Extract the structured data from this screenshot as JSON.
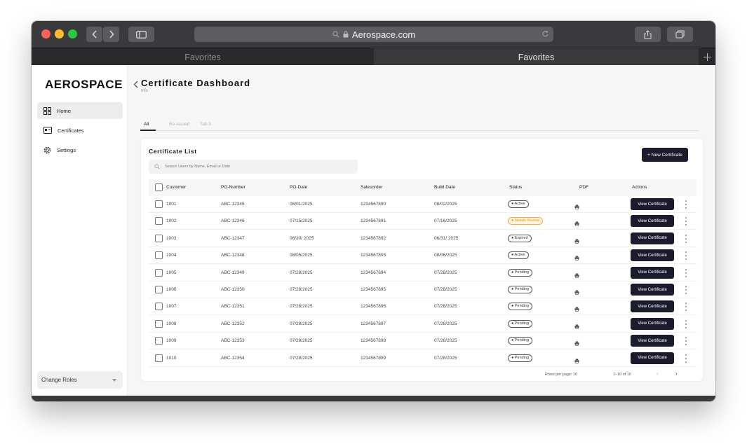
{
  "browser": {
    "url": "Aerospace.com",
    "tabs": [
      {
        "label": "Favorites",
        "active": false
      },
      {
        "label": "Favorites",
        "active": true
      }
    ],
    "colors": {
      "close": "#fe5f57",
      "minimize": "#febc2e",
      "maximize": "#28c840"
    }
  },
  "sidebar": {
    "logo": "AEROSPACE",
    "items": [
      {
        "label": "Home",
        "icon": "grid-icon",
        "active": true
      },
      {
        "label": "Certificates",
        "icon": "certificate-icon",
        "active": false
      },
      {
        "label": "Settings",
        "icon": "gear-icon",
        "active": false
      }
    ],
    "change_roles": "Change Roles"
  },
  "header": {
    "title": "Certificate Dashboard",
    "subtitle": "Info"
  },
  "tabs": [
    "All",
    "Re-issued",
    "Tab 3"
  ],
  "card": {
    "title": "Certificate List",
    "new_button": "+ New Certificate",
    "search_placeholder": "Search Users by Name, Email or Date",
    "columns": [
      "Customer",
      "PO-Number",
      "PO-Date",
      "Salesorder",
      "Build Date",
      "Status",
      "PDF",
      "Actions"
    ],
    "rows": [
      {
        "customer": "1001",
        "po_number": "ABC-12345",
        "po_date": "08/01/2025",
        "salesorder": "1234567890",
        "build_date": "08/02/2025",
        "status": "Active",
        "status_type": "default",
        "action": "View Certificate"
      },
      {
        "customer": "1002",
        "po_number": "ABC-12346",
        "po_date": "07/15/2025",
        "salesorder": "1234567891",
        "build_date": "07/16/2025",
        "status": "Needs Review",
        "status_type": "review",
        "action": "View Certificate"
      },
      {
        "customer": "1003",
        "po_number": "ABC-12347",
        "po_date": "06/30/ 2025",
        "salesorder": "1234567892",
        "build_date": "06/31/ 2025",
        "status": "Expired",
        "status_type": "default",
        "action": "View Certificate"
      },
      {
        "customer": "1004",
        "po_number": "ABC-12348",
        "po_date": "08/05/2025",
        "salesorder": "1234567893",
        "build_date": "08/06/2025",
        "status": "Active",
        "status_type": "default",
        "action": "View Certificate"
      },
      {
        "customer": "1005",
        "po_number": "ABC-12349",
        "po_date": "07/28/2025",
        "salesorder": "1234567894",
        "build_date": "07/28/2025",
        "status": "Pending",
        "status_type": "default",
        "action": "View Certificate"
      },
      {
        "customer": "1006",
        "po_number": "ABC-12350",
        "po_date": "07/28/2025",
        "salesorder": "1234567895",
        "build_date": "07/28/2025",
        "status": "Pending",
        "status_type": "default",
        "action": "View Certificate"
      },
      {
        "customer": "1007",
        "po_number": "ABC-12351",
        "po_date": "07/28/2025",
        "salesorder": "1234567896",
        "build_date": "07/28/2025",
        "status": "Pending",
        "status_type": "default",
        "action": "View Certificate"
      },
      {
        "customer": "1008",
        "po_number": "ABC-12352",
        "po_date": "07/28/2025",
        "salesorder": "1234567897",
        "build_date": "07/28/2025",
        "status": "Pending",
        "status_type": "default",
        "action": "View Certificate"
      },
      {
        "customer": "1009",
        "po_number": "ABC-12353",
        "po_date": "07/28/2025",
        "salesorder": "1234567898",
        "build_date": "07/28/2025",
        "status": "Pending",
        "status_type": "default",
        "action": "View Certificate"
      },
      {
        "customer": "1010",
        "po_number": "ABC-12354",
        "po_date": "07/28/2025",
        "salesorder": "1234567899",
        "build_date": "07/28/2025",
        "status": "Pending",
        "status_type": "default",
        "action": "View Certificate"
      }
    ],
    "footer": {
      "rows_per_page": "Rows per page: 10",
      "range": "1–10 of 10",
      "prev": "‹",
      "next": "›"
    }
  },
  "colors": {
    "primary_button": "#1c1b2e",
    "review_badge": "#f0b24a"
  }
}
